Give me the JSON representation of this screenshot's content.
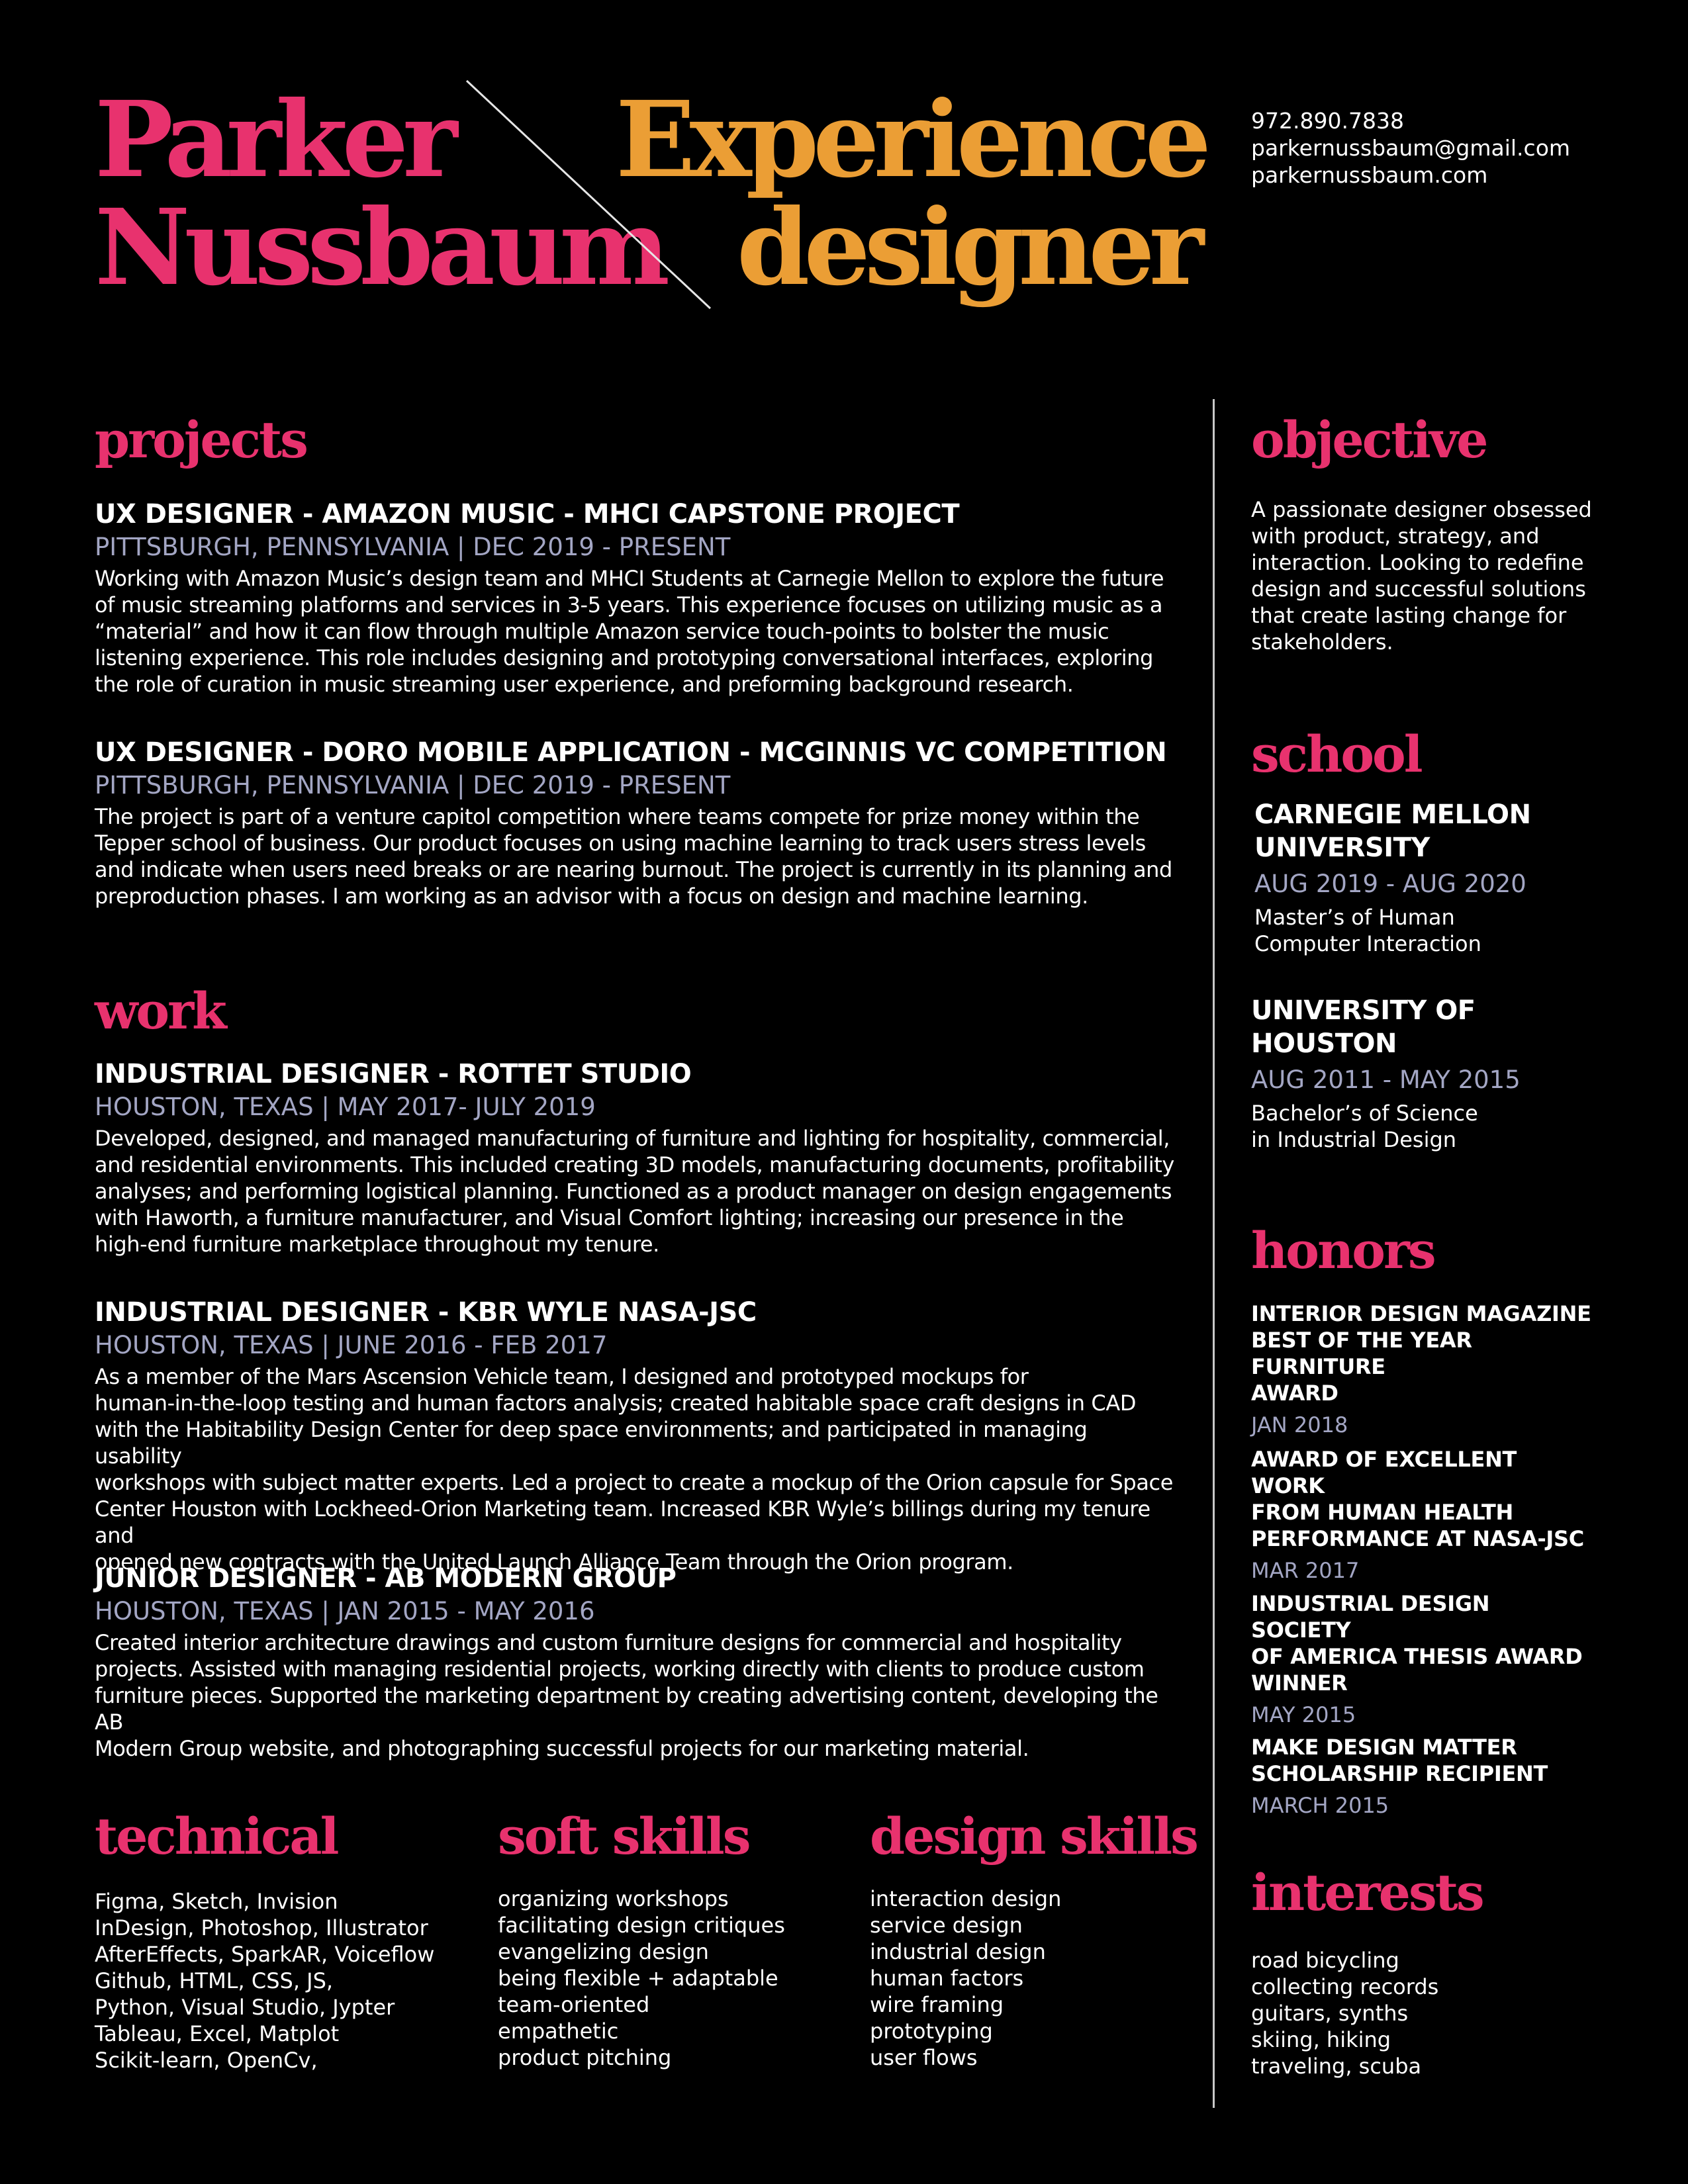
{
  "header": {
    "name_line1": "Parker",
    "name_line2": "Nussbaum",
    "title_line1": "Experience",
    "title_line2": "designer",
    "phone": "972.890.7838",
    "email": "parkernussbaum@gmail.com",
    "website": "parkernussbaum.com"
  },
  "colors": {
    "accent_pink": "#e8326e",
    "accent_orange": "#eb9e35",
    "muted": "#a3a6c4",
    "background": "#000000"
  },
  "projects": {
    "heading": "projects",
    "entries": [
      {
        "title": "UX DESIGNER - AMAZON MUSIC - MHCI CAPSTONE PROJECT",
        "sub": "PITTSBURGH, PENNSYLVANIA | DEC 2019 - PRESENT",
        "lines": [
          "Working with Amazon Music’s design team and MHCI Students at Carnegie Mellon to explore the future",
          "of music streaming platforms and services in 3-5 years. This experience focuses on utilizing music as a",
          "“material” and how it can flow through multiple Amazon service touch-points to bolster the music",
          "listening experience. This role includes designing and prototyping conversational interfaces, exploring",
          "the role of curation in music streaming user experience, and preforming background research."
        ]
      },
      {
        "title": "UX DESIGNER - DORO MOBILE APPLICATION - MCGINNIS VC COMPETITION",
        "sub": "PITTSBURGH, PENNSYLVANIA | DEC 2019 - PRESENT",
        "lines": [
          "The project is part of a venture capitol competition where teams compete for prize money within the",
          "Tepper school of business. Our product focuses on using machine learning to track users stress levels",
          "and indicate when users need breaks or are nearing burnout. The project is currently in its planning and",
          "preproduction phases. I am working as an advisor with a focus on design and machine learning."
        ]
      }
    ]
  },
  "work": {
    "heading": "work",
    "entries": [
      {
        "title": "INDUSTRIAL DESIGNER - ROTTET STUDIO",
        "sub": "HOUSTON, TEXAS | MAY 2017- JULY 2019",
        "lines": [
          "Developed, designed, and managed manufacturing of furniture and lighting for hospitality, commercial,",
          "and residential environments. This included creating 3D models, manufacturing documents, profitability",
          "analyses; and performing logistical planning. Functioned as a product manager on design engagements",
          "with Haworth, a furniture manufacturer, and Visual Comfort lighting; increasing our presence in the",
          "high-end furniture marketplace throughout my tenure."
        ]
      },
      {
        "title": "INDUSTRIAL DESIGNER - KBR WYLE NASA-JSC",
        "sub": "HOUSTON, TEXAS | JUNE 2016 - FEB 2017",
        "lines": [
          "As a member of the Mars Ascension Vehicle team, I designed and prototyped mockups for",
          "human-in-the-loop testing and human factors analysis; created habitable space craft designs in CAD",
          "with the Habitability Design Center for deep space environments; and participated in managing usability",
          "workshops with subject matter experts. Led a project to create a mockup of the Orion capsule for Space",
          "Center Houston with Lockheed-Orion Marketing team. Increased KBR Wyle’s billings during my tenure and",
          "opened new contracts with the United Launch Alliance Team through the Orion program."
        ]
      },
      {
        "title": "JUNIOR DESIGNER - AB MODERN GROUP",
        "sub": "HOUSTON, TEXAS | JAN 2015 - MAY 2016",
        "lines": [
          "Created interior architecture drawings and custom furniture designs for commercial and hospitality",
          "projects. Assisted with managing residential projects, working directly with clients to produce custom",
          "furniture pieces. Supported the marketing department by creating advertising content, developing the AB",
          "Modern Group website, and photographing successful projects for our marketing material."
        ]
      }
    ]
  },
  "technical": {
    "heading": "technical",
    "items": [
      "Figma, Sketch, Invision",
      "InDesign, Photoshop, Illustrator",
      "AfterEffects, SparkAR, Voiceflow",
      "Github, HTML, CSS, JS,",
      "Python, Visual Studio, Jypter",
      "Tableau, Excel, Matplot",
      "Scikit-learn, OpenCv,"
    ]
  },
  "soft_skills": {
    "heading": "soft skills",
    "items": [
      "organizing workshops",
      "facilitating design critiques",
      "evangelizing design",
      "being flexible + adaptable",
      "team-oriented",
      "empathetic",
      "product pitching"
    ]
  },
  "design_skills": {
    "heading": "design skills",
    "items": [
      "interaction design",
      "service design",
      "industrial design",
      "human factors",
      "wire framing",
      "prototyping",
      "user flows"
    ]
  },
  "objective": {
    "heading": "objective",
    "lines": [
      "A passionate designer obsessed",
      "with product, strategy, and",
      "interaction. Looking to redefine",
      "design and successful solutions",
      "that create lasting change for",
      "stakeholders."
    ]
  },
  "school": {
    "heading": "school",
    "entries": [
      {
        "name_lines": [
          "CARNEGIE MELLON",
          "UNIVERSITY"
        ],
        "dates": "AUG 2019 - AUG 2020",
        "degree_lines": [
          "Master’s of Human",
          "Computer Interaction"
        ]
      },
      {
        "name_lines": [
          "UNIVERSITY OF",
          "HOUSTON"
        ],
        "dates": "AUG 2011 - MAY 2015",
        "degree_lines": [
          "Bachelor’s of Science",
          "in Industrial Design"
        ]
      }
    ]
  },
  "honors": {
    "heading": "honors",
    "entries": [
      {
        "title_lines": [
          "INTERIOR DESIGN MAGAZINE",
          "BEST OF THE YEAR FURNITURE",
          "AWARD"
        ],
        "date": "JAN 2018"
      },
      {
        "title_lines": [
          "AWARD OF EXCELLENT WORK",
          "FROM HUMAN HEALTH",
          "PERFORMANCE AT NASA-JSC"
        ],
        "date": "MAR 2017"
      },
      {
        "title_lines": [
          "INDUSTRIAL DESIGN SOCIETY",
          "OF AMERICA THESIS AWARD",
          "WINNER"
        ],
        "date": "MAY 2015"
      },
      {
        "title_lines": [
          "MAKE DESIGN MATTER",
          "SCHOLARSHIP RECIPIENT"
        ],
        "date": "MARCH 2015"
      }
    ]
  },
  "interests": {
    "heading": "interests",
    "items": [
      "road bicycling",
      "collecting records",
      "guitars, synths",
      "skiing, hiking",
      "traveling, scuba"
    ]
  }
}
